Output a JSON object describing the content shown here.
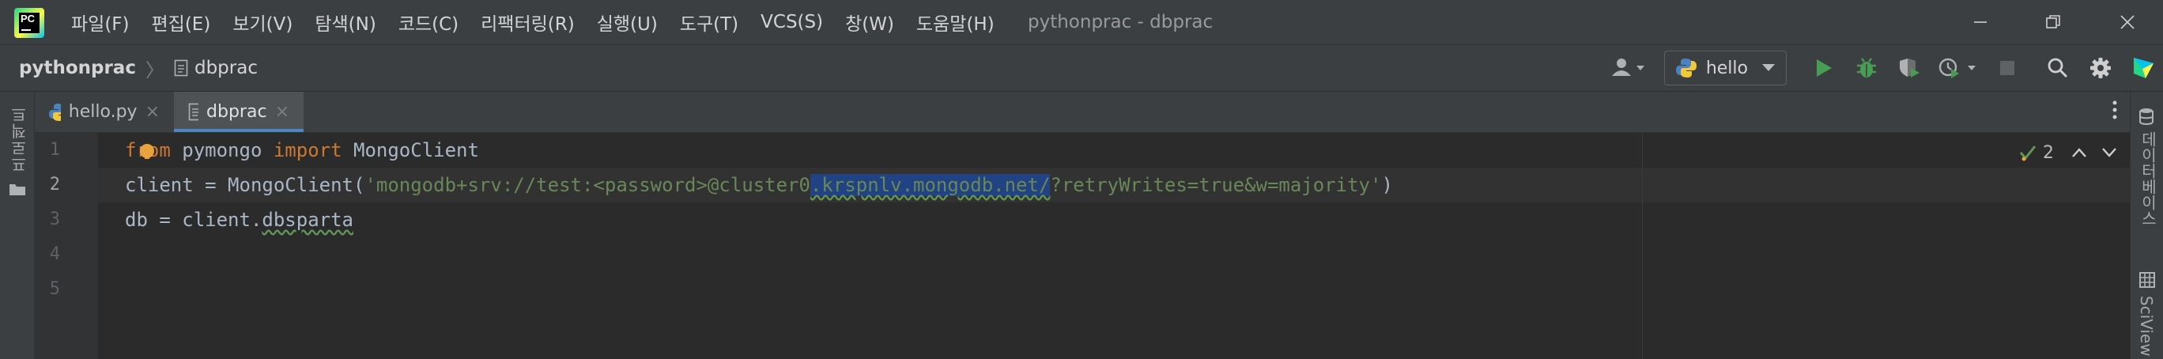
{
  "window": {
    "menu": [
      "파일(F)",
      "편집(E)",
      "보기(V)",
      "탐색(N)",
      "코드(C)",
      "리팩터링(R)",
      "실행(U)",
      "도구(T)",
      "VCS(S)",
      "창(W)",
      "도움말(H)"
    ],
    "title": "pythonprac - dbprac"
  },
  "breadcrumb": {
    "project": "pythonprac",
    "file": "dbprac"
  },
  "run_config": {
    "label": "hello"
  },
  "tool_windows": {
    "left": "프로젝트",
    "right_top": "데이터베이스",
    "right_bottom": "SciView"
  },
  "tabs": [
    {
      "label": "hello.py",
      "active": false
    },
    {
      "label": "dbprac",
      "active": true
    }
  ],
  "inspections": {
    "count": "2",
    "color": "#629755"
  },
  "editor": {
    "line_numbers": [
      "1",
      "2",
      "3",
      "4",
      "5"
    ],
    "current_line": "2",
    "line1": {
      "kw1": "from",
      "t1": " pymongo ",
      "kw2": "import",
      "t2": " MongoClient"
    },
    "line2": {
      "t1": "client = MongoClient(",
      "s1": "'mongodb+srv://test:<password>@cluster0",
      "sel": ".krspnlv.mongodb.net/",
      "s2": "?retryWrites=true&w=majority'",
      "t2": ")"
    },
    "line3": {
      "t1": "db = client.",
      "t2": "dbsparta"
    }
  },
  "colors": {
    "accent": "#4a88c7",
    "keyword": "#cc7832",
    "string": "#6a8759",
    "selection": "#214283"
  }
}
